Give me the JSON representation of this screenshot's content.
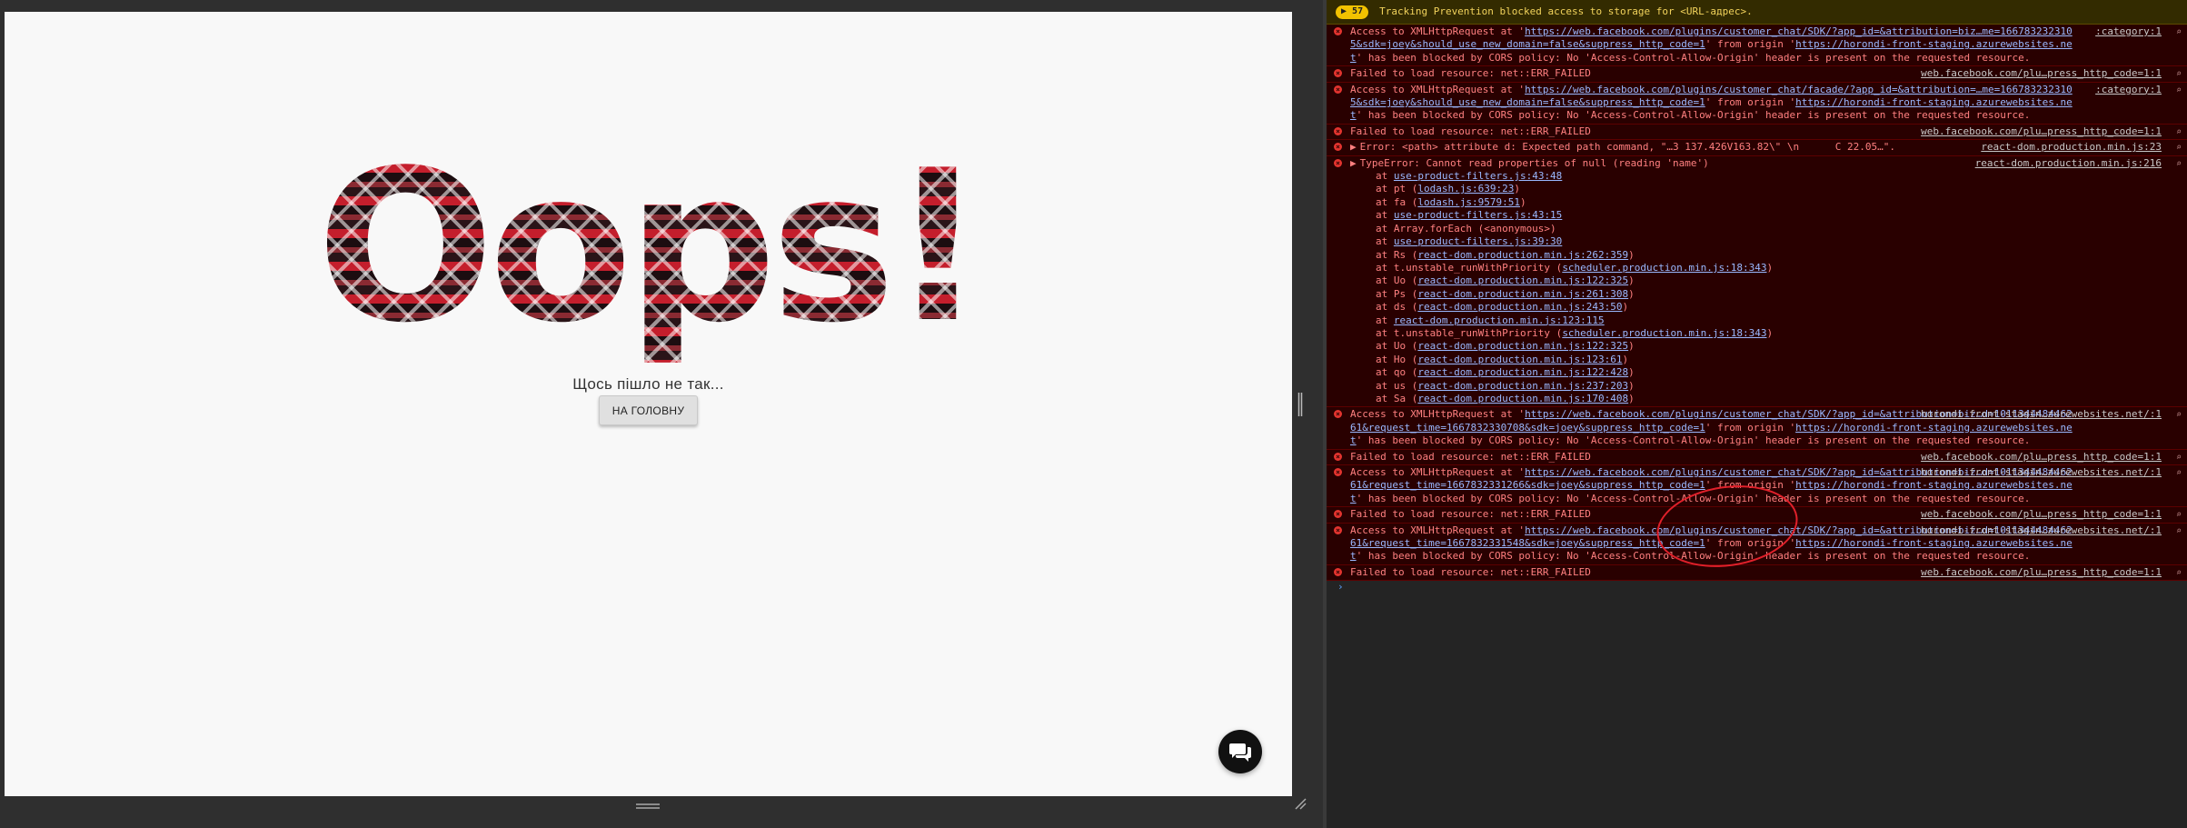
{
  "page": {
    "heading": "Oops!",
    "subtitle": "Щось пішло не так...",
    "home_button": "НА ГОЛОВНУ",
    "chat_icon": "chat-bubble-icon"
  },
  "console": {
    "warn_count": "57",
    "warn_text": "Tracking Prevention blocked access to storage for <URL-адрес>.",
    "messages": [
      {
        "parts": [
          "Access to XMLHttpRequest at '",
          "https://web.facebook.com/plugins/customer_chat/SDK/?app_id=&attribution=biz…me=1667832323105&sdk=joey&should_use_new_domain=false&suppress_http_code=1",
          "' from origin '",
          "https://horondi-front-staging.azurewebsites.net",
          "' has been blocked by CORS policy: No 'Access-Control-Allow-Origin' header is present on the requested resource."
        ],
        "src": ":category:1"
      },
      {
        "parts": [
          "Failed to load resource: net::ERR_FAILED"
        ],
        "src": "web.facebook.com/plu…press_http_code=1:1"
      },
      {
        "parts": [
          "Access to XMLHttpRequest at '",
          "https://web.facebook.com/plugins/customer_chat/facade/?app_id=&attribution=…me=1667832323105&sdk=joey&should_use_new_domain=false&suppress_http_code=1",
          "' from origin '",
          "https://horondi-front-staging.azurewebsites.net",
          "' has been blocked by CORS policy: No 'Access-Control-Allow-Origin' header is present on the requested resource."
        ],
        "src": ":category:1"
      },
      {
        "parts": [
          "Failed to load resource: net::ERR_FAILED"
        ],
        "src": "web.facebook.com/plu…press_http_code=1:1"
      },
      {
        "parts": [
          "Error: <path> attribute d: Expected path command, \"…3 137.426V163.82\\\" \\n      C 22.05…\"."
        ],
        "src": "react-dom.production.min.js:23",
        "expand": true
      },
      {
        "parts": [
          "TypeError: Cannot read properties of null (reading 'name')"
        ],
        "src": "react-dom.production.min.js:216",
        "expand": true,
        "stack": [
          [
            "at ",
            "use-product-filters.js:43:48"
          ],
          [
            "at pt (",
            "lodash.js:639:23",
            ")"
          ],
          [
            "at fa (",
            "lodash.js:9579:51",
            ")"
          ],
          [
            "at ",
            "use-product-filters.js:43:15"
          ],
          [
            "at Array.forEach (<anonymous>)"
          ],
          [
            "at ",
            "use-product-filters.js:39:30"
          ],
          [
            "at Rs (",
            "react-dom.production.min.js:262:359",
            ")"
          ],
          [
            "at t.unstable_runWithPriority (",
            "scheduler.production.min.js:18:343",
            ")"
          ],
          [
            "at Uo (",
            "react-dom.production.min.js:122:325",
            ")"
          ],
          [
            "at Ps (",
            "react-dom.production.min.js:261:308",
            ")"
          ],
          [
            "at ds (",
            "react-dom.production.min.js:243:50",
            ")"
          ],
          [
            "at ",
            "react-dom.production.min.js:123:115"
          ],
          [
            "at t.unstable_runWithPriority (",
            "scheduler.production.min.js:18:343",
            ")"
          ],
          [
            "at Uo (",
            "react-dom.production.min.js:122:325",
            ")"
          ],
          [
            "at Ho (",
            "react-dom.production.min.js:123:61",
            ")"
          ],
          [
            "at qo (",
            "react-dom.production.min.js:122:428",
            ")"
          ],
          [
            "at us (",
            "react-dom.production.min.js:237:203",
            ")"
          ],
          [
            "at Sa (",
            "react-dom.production.min.js:170:408",
            ")"
          ]
        ]
      },
      {
        "parts": [
          "Access to XMLHttpRequest at '",
          "https://web.facebook.com/plugins/customer_chat/SDK/?app_id=&attribution=biz…d=101134448446261&request_time=1667832330708&sdk=joey&suppress_http_code=1",
          "' from origin '",
          "https://horondi-front-staging.azurewebsites.net",
          "' has been blocked by CORS policy: No 'Access-Control-Allow-Origin' header is present on the requested resource."
        ],
        "src": "horondi-front-stagin…zurewebsites.net/:1"
      },
      {
        "parts": [
          "Failed to load resource: net::ERR_FAILED"
        ],
        "src": "web.facebook.com/plu…press_http_code=1:1"
      },
      {
        "parts": [
          "Access to XMLHttpRequest at '",
          "https://web.facebook.com/plugins/customer_chat/SDK/?app_id=&attribution=biz…d=101134448446261&request_time=1667832331266&sdk=joey&suppress_http_code=1",
          "' from origin '",
          "https://horondi-front-staging.azurewebsites.net",
          "' has been blocked by CORS policy: No 'Access-Control-Allow-Origin' header is present on the requested resource."
        ],
        "src": "horondi-front-stagin…zurewebsites.net/:1"
      },
      {
        "parts": [
          "Failed to load resource: net::ERR_FAILED"
        ],
        "src": "web.facebook.com/plu…press_http_code=1:1"
      },
      {
        "parts": [
          "Access to XMLHttpRequest at '",
          "https://web.facebook.com/plugins/customer_chat/SDK/?app_id=&attribution=biz…d=101134448446261&request_time=1667832331548&sdk=joey&suppress_http_code=1",
          "' from origin '",
          "https://horondi-front-staging.azurewebsites.net",
          "' has been blocked by CORS policy: No 'Access-Control-Allow-Origin' header is present on the requested resource."
        ],
        "src": "horondi-front-stagin…zurewebsites.net/:1"
      },
      {
        "parts": [
          "Failed to load resource: net::ERR_FAILED"
        ],
        "src": "web.facebook.com/plu…press_http_code=1:1"
      }
    ],
    "prompt": "›"
  }
}
